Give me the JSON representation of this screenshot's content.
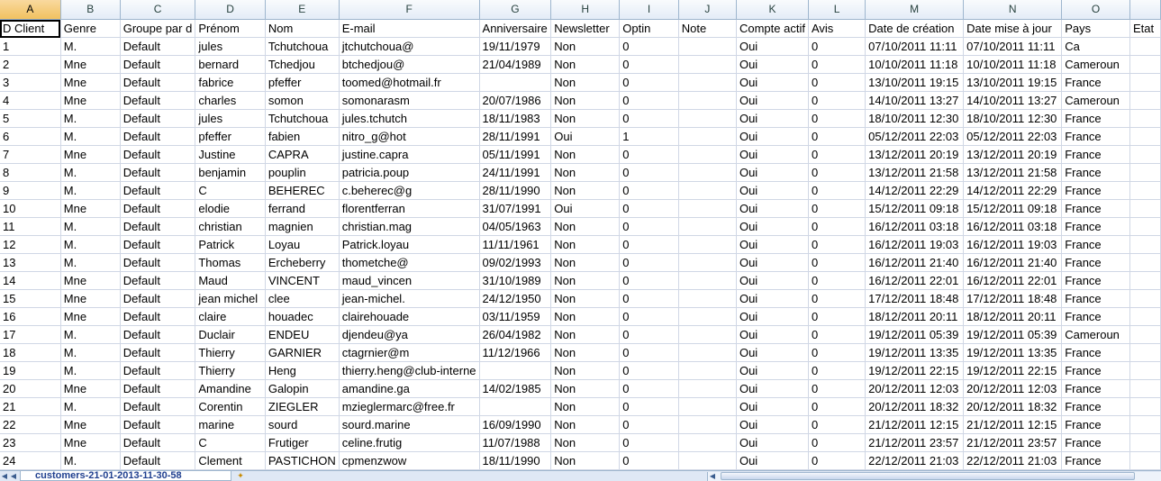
{
  "columns": [
    "A",
    "B",
    "C",
    "D",
    "E",
    "F",
    "G",
    "H",
    "I",
    "J",
    "K",
    "L",
    "M",
    "N",
    "O",
    ""
  ],
  "headers": [
    "D Client",
    "Genre",
    "Groupe par d",
    "Prénom",
    "Nom",
    "E-mail",
    "Anniversaire",
    "Newsletter",
    "Optin",
    "Note",
    "Compte actif",
    "Avis",
    "Date de création",
    "Date mise à jour",
    "Pays",
    "Etat"
  ],
  "rows": [
    [
      "1",
      "M.",
      "Default",
      "jules",
      "Tchutchoua",
      "jtchutchoua@",
      "19/11/1979",
      "Non",
      "0",
      "",
      "Oui",
      "0",
      "07/10/2011 11:11",
      "07/10/2011 11:11",
      "Ca",
      ""
    ],
    [
      "2",
      "Mne",
      "Default",
      "bernard",
      "Tchedjou",
      "btchedjou@",
      "21/04/1989",
      "Non",
      "0",
      "",
      "Oui",
      "0",
      "10/10/2011 11:18",
      "10/10/2011 11:18",
      "Cameroun",
      ""
    ],
    [
      "3",
      "Mne",
      "Default",
      "fabrice",
      "pfeffer",
      "toomed@hotmail.fr",
      "",
      "Non",
      "0",
      "",
      "Oui",
      "0",
      "13/10/2011 19:15",
      "13/10/2011 19:15",
      "France",
      ""
    ],
    [
      "4",
      "Mne",
      "Default",
      "charles",
      "somon",
      "somonarasm",
      "20/07/1986",
      "Non",
      "0",
      "",
      "Oui",
      "0",
      "14/10/2011 13:27",
      "14/10/2011 13:27",
      "Cameroun",
      ""
    ],
    [
      "5",
      "M.",
      "Default",
      "jules",
      "Tchutchoua",
      "jules.tchutch",
      "18/11/1983",
      "Non",
      "0",
      "",
      "Oui",
      "0",
      "18/10/2011 12:30",
      "18/10/2011 12:30",
      "France",
      ""
    ],
    [
      "6",
      "M.",
      "Default",
      "pfeffer",
      "fabien",
      "nitro_g@hot",
      "28/11/1991",
      "Oui",
      "1",
      "",
      "Oui",
      "0",
      "05/12/2011 22:03",
      "05/12/2011 22:03",
      "France",
      ""
    ],
    [
      "7",
      "Mne",
      "Default",
      "Justine",
      "CAPRA",
      "justine.capra",
      "05/11/1991",
      "Non",
      "0",
      "",
      "Oui",
      "0",
      "13/12/2011 20:19",
      "13/12/2011 20:19",
      "France",
      ""
    ],
    [
      "8",
      "M.",
      "Default",
      "benjamin",
      "pouplin",
      "patricia.poup",
      "24/11/1991",
      "Non",
      "0",
      "",
      "Oui",
      "0",
      "13/12/2011 21:58",
      "13/12/2011 21:58",
      "France",
      ""
    ],
    [
      "9",
      "M.",
      "Default",
      "C",
      "BEHEREC",
      "c.beherec@g",
      "28/11/1990",
      "Non",
      "0",
      "",
      "Oui",
      "0",
      "14/12/2011 22:29",
      "14/12/2011 22:29",
      "France",
      ""
    ],
    [
      "10",
      "Mne",
      "Default",
      "elodie",
      "ferrand",
      "florentferran",
      "31/07/1991",
      "Oui",
      "0",
      "",
      "Oui",
      "0",
      "15/12/2011 09:18",
      "15/12/2011 09:18",
      "France",
      ""
    ],
    [
      "11",
      "M.",
      "Default",
      "christian",
      "magnien",
      "christian.mag",
      "04/05/1963",
      "Non",
      "0",
      "",
      "Oui",
      "0",
      "16/12/2011 03:18",
      "16/12/2011 03:18",
      "France",
      ""
    ],
    [
      "12",
      "M.",
      "Default",
      "Patrick",
      "Loyau",
      "Patrick.loyau",
      "11/11/1961",
      "Non",
      "0",
      "",
      "Oui",
      "0",
      "16/12/2011 19:03",
      "16/12/2011 19:03",
      "France",
      ""
    ],
    [
      "13",
      "M.",
      "Default",
      "Thomas",
      "Ercheberry",
      "thometche@",
      "09/02/1993",
      "Non",
      "0",
      "",
      "Oui",
      "0",
      "16/12/2011 21:40",
      "16/12/2011 21:40",
      "France",
      ""
    ],
    [
      "14",
      "Mne",
      "Default",
      "Maud",
      "VINCENT",
      "maud_vincen",
      "31/10/1989",
      "Non",
      "0",
      "",
      "Oui",
      "0",
      "16/12/2011 22:01",
      "16/12/2011 22:01",
      "France",
      ""
    ],
    [
      "15",
      "Mne",
      "Default",
      "jean michel",
      "clee",
      "jean-michel.",
      "24/12/1950",
      "Non",
      "0",
      "",
      "Oui",
      "0",
      "17/12/2011 18:48",
      "17/12/2011 18:48",
      "France",
      ""
    ],
    [
      "16",
      "Mne",
      "Default",
      "claire",
      "houadec",
      "clairehouade",
      "03/11/1959",
      "Non",
      "0",
      "",
      "Oui",
      "0",
      "18/12/2011 20:11",
      "18/12/2011 20:11",
      "France",
      ""
    ],
    [
      "17",
      "M.",
      "Default",
      "Duclair",
      "ENDEU",
      "djendeu@ya",
      "26/04/1982",
      "Non",
      "0",
      "",
      "Oui",
      "0",
      "19/12/2011 05:39",
      "19/12/2011 05:39",
      "Cameroun",
      ""
    ],
    [
      "18",
      "M.",
      "Default",
      "Thierry",
      "GARNIER",
      "ctagrnier@m",
      "11/12/1966",
      "Non",
      "0",
      "",
      "Oui",
      "0",
      "19/12/2011 13:35",
      "19/12/2011 13:35",
      "France",
      ""
    ],
    [
      "19",
      "M.",
      "Default",
      "Thierry",
      "Heng",
      "thierry.heng@club-interne",
      "",
      "Non",
      "0",
      "",
      "Oui",
      "0",
      "19/12/2011 22:15",
      "19/12/2011 22:15",
      "France",
      ""
    ],
    [
      "20",
      "Mne",
      "Default",
      "Amandine",
      "Galopin",
      "amandine.ga",
      "14/02/1985",
      "Non",
      "0",
      "",
      "Oui",
      "0",
      "20/12/2011 12:03",
      "20/12/2011 12:03",
      "France",
      ""
    ],
    [
      "21",
      "M.",
      "Default",
      "Corentin",
      "ZIEGLER",
      "mzieglermarc@free.fr",
      "",
      "Non",
      "0",
      "",
      "Oui",
      "0",
      "20/12/2011 18:32",
      "20/12/2011 18:32",
      "France",
      ""
    ],
    [
      "22",
      "Mne",
      "Default",
      "marine",
      "sourd",
      "sourd.marine",
      "16/09/1990",
      "Non",
      "0",
      "",
      "Oui",
      "0",
      "21/12/2011 12:15",
      "21/12/2011 12:15",
      "France",
      ""
    ],
    [
      "23",
      "Mne",
      "Default",
      "C",
      "Frutiger",
      "celine.frutig",
      "11/07/1988",
      "Non",
      "0",
      "",
      "Oui",
      "0",
      "21/12/2011 23:57",
      "21/12/2011 23:57",
      "France",
      ""
    ],
    [
      "24",
      "M.",
      "Default",
      "Clement",
      "PASTICHON",
      "cpmenzwow",
      "18/11/1990",
      "Non",
      "0",
      "",
      "Oui",
      "0",
      "22/12/2011 21:03",
      "22/12/2011 21:03",
      "France",
      ""
    ]
  ],
  "sheet_tab": "customers-21-01-2013-11-30-58"
}
